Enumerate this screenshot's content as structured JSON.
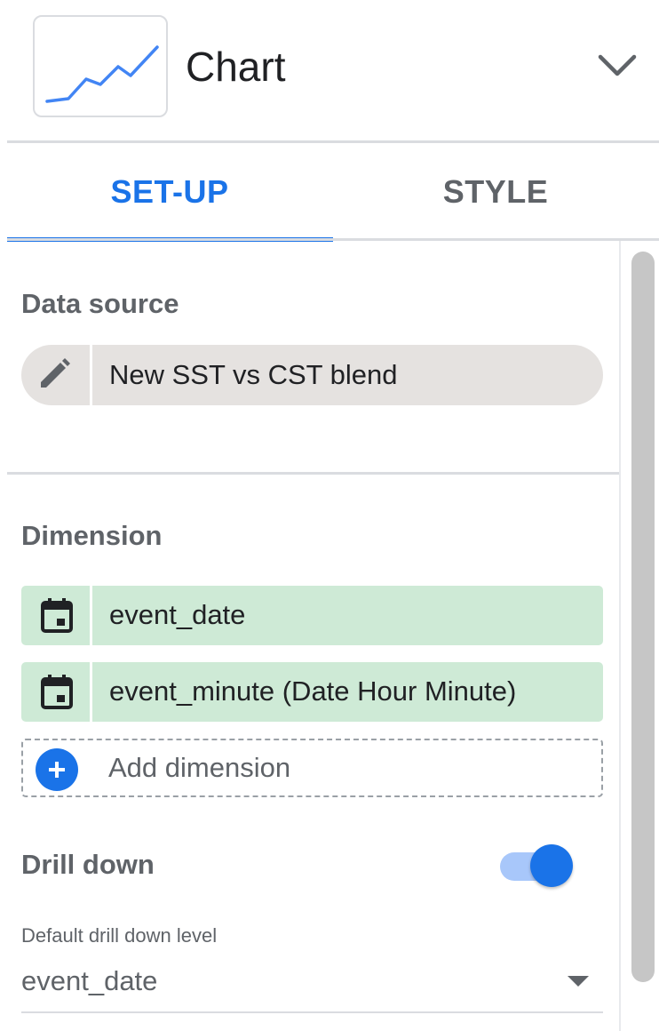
{
  "header": {
    "title": "Chart",
    "thumbnail_icon": "line-chart-icon",
    "dropdown_icon": "chevron-down-icon"
  },
  "tabs": [
    {
      "label": "SET-UP",
      "active": true
    },
    {
      "label": "STYLE",
      "active": false
    }
  ],
  "data_source": {
    "section_label": "Data source",
    "name": "New SST vs CST blend",
    "edit_icon": "pencil-icon"
  },
  "dimension": {
    "section_label": "Dimension",
    "items": [
      {
        "label": "event_date",
        "icon": "calendar-icon"
      },
      {
        "label": "event_minute (Date Hour Minute)",
        "icon": "calendar-icon"
      }
    ],
    "add_label": "Add dimension",
    "add_icon": "plus-icon"
  },
  "drill_down": {
    "label": "Drill down",
    "enabled": true,
    "default_level_label": "Default drill down level",
    "default_level_value": "event_date",
    "dropdown_icon": "caret-down-icon"
  },
  "colors": {
    "accent": "#1a73e8",
    "chip_green": "#ceead6",
    "pill_grey": "#e5e2e0",
    "toggle_track": "#a8c7fa"
  }
}
